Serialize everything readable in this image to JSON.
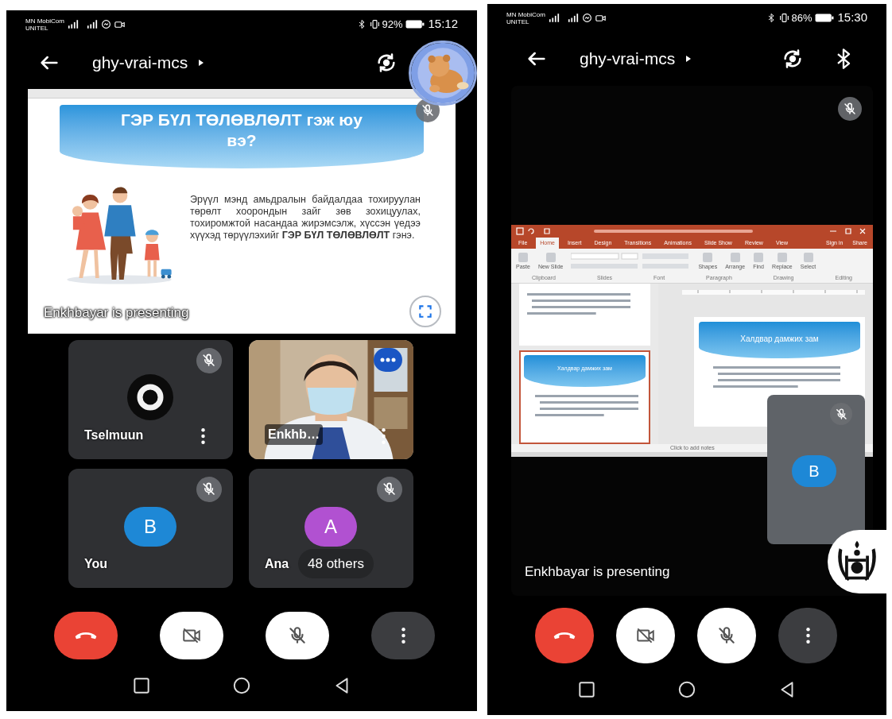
{
  "phones": [
    {
      "status_bar": {
        "carrier": "MN MobiCom",
        "carrier_2": "UNITEL",
        "battery": "92%",
        "time": "15:12"
      },
      "top_bar": {
        "meeting_code": "ghy-vrai-mcs",
        "actions": [
          {
            "kind": "flip_camera"
          }
        ]
      },
      "chat_head": {
        "kind": "bear"
      },
      "stage": {
        "kind": "slide",
        "muted": true,
        "fullscreen_button": true,
        "presenter_label": "Enkhbayar is presenting",
        "slide": {
          "title": "ГЭР БҮЛ ТӨЛӨВЛӨЛТ гэж юу вэ?",
          "body": "Эрүүл мэнд амьдралын байдалдаа тохируулан төрөлт хоорондын зайг зөв зохицуулах, тохиромжтой насандаа жирэмсэлж, хүссэн үедээ хүүхэд төрүүлэхийг **ГЭР БҮЛ ТӨЛӨВЛӨЛТ** гэнэ."
        }
      },
      "tiles": [
        {
          "kind": "icon",
          "name": "Tselmuun",
          "muted": true,
          "speaking": false,
          "menu": true
        },
        {
          "kind": "video",
          "name": "Enkhb…",
          "muted": false,
          "speaking": true,
          "menu": true
        },
        {
          "kind": "letter",
          "name": "You",
          "letter": "B",
          "color": "#1e88d6",
          "muted": true,
          "speaking": false,
          "menu": false
        },
        {
          "kind": "letter",
          "name": "Ana",
          "letter": "A",
          "color": "#b151d1",
          "muted": true,
          "speaking": false,
          "menu": false,
          "overlay": "48 others"
        }
      ],
      "controls": [
        {
          "kind": "end_call"
        },
        {
          "kind": "camera_off"
        },
        {
          "kind": "mic_off"
        },
        {
          "kind": "more"
        }
      ],
      "nav_buttons": [
        {
          "kind": "recents"
        },
        {
          "kind": "home"
        },
        {
          "kind": "back"
        }
      ]
    },
    {
      "status_bar": {
        "carrier": "MN MobiCom",
        "carrier_2": "UNITEL",
        "battery": "86%",
        "time": "15:30"
      },
      "top_bar": {
        "meeting_code": "ghy-vrai-mcs",
        "actions": [
          {
            "kind": "flip_camera"
          },
          {
            "kind": "bluetooth"
          }
        ]
      },
      "chat_head": {
        "kind": "emblem"
      },
      "stage": {
        "kind": "screen_share",
        "muted": true,
        "fullscreen_button": false,
        "presenter_label": "Enkhbayar is presenting",
        "ppt": {
          "tabs": [
            {
              "label": "File",
              "selected": false
            },
            {
              "label": "Home",
              "selected": true
            },
            {
              "label": "Insert",
              "selected": false
            },
            {
              "label": "Design",
              "selected": false
            },
            {
              "label": "Transitions",
              "selected": false
            },
            {
              "label": "Animations",
              "selected": false
            },
            {
              "label": "Slide Show",
              "selected": false
            },
            {
              "label": "Review",
              "selected": false
            },
            {
              "label": "View",
              "selected": false
            }
          ],
          "account": [
            "Sign in",
            "Share"
          ],
          "ribbon_buttons": [
            "Paste",
            "New Slide",
            "Shapes",
            "Arrange",
            "Find",
            "Replace",
            "Select"
          ],
          "ribbon_groups": [
            "Clipboard",
            "Slides",
            "Font",
            "Paragraph",
            "Drawing",
            "Editing"
          ],
          "thumbnail_title": "Халдвар дамжих зам",
          "slide_title": "Халдвар дамжих зам",
          "notes_placeholder": "Click to add notes"
        },
        "self_tile": {
          "letter": "B",
          "color": "#1e88d6",
          "muted": true
        }
      },
      "controls": [
        {
          "kind": "end_call"
        },
        {
          "kind": "camera_off"
        },
        {
          "kind": "mic_off"
        },
        {
          "kind": "more"
        }
      ],
      "nav_buttons": [
        {
          "kind": "recents"
        },
        {
          "kind": "home"
        },
        {
          "kind": "back"
        }
      ]
    }
  ]
}
